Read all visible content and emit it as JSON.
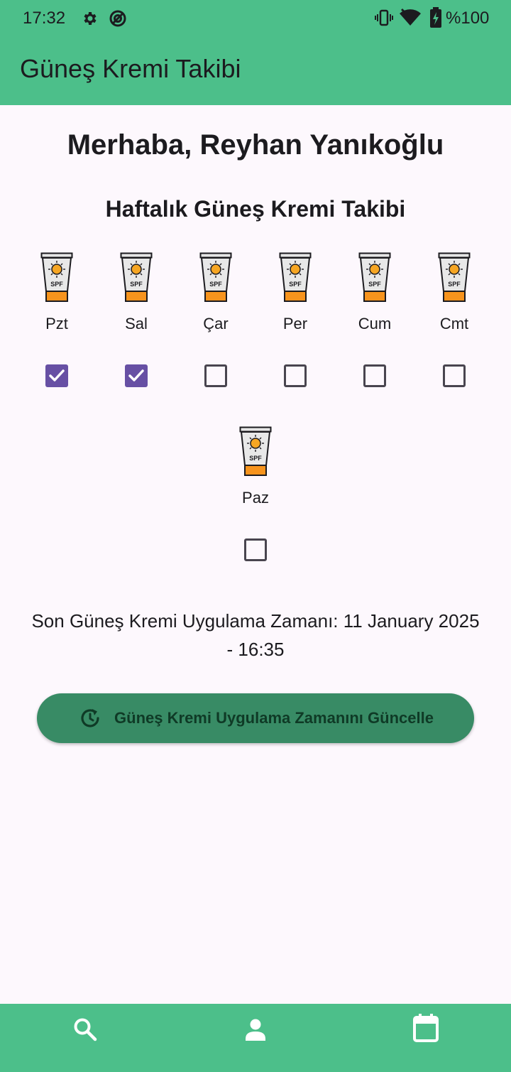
{
  "status_bar": {
    "time": "17:32",
    "battery": "%100",
    "icons": [
      "gear-icon",
      "data-saver-icon",
      "vibrate-icon",
      "wifi-icon",
      "battery-charging-icon"
    ]
  },
  "app_bar": {
    "title": "Güneş Kremi Takibi",
    "color": "#4cbf8a"
  },
  "main": {
    "greeting": "Merhaba, Reyhan Yanıkoğlu",
    "section_title": "Haftalık Güneş Kremi Takibi",
    "days": [
      {
        "label": "Pzt",
        "checked": true
      },
      {
        "label": "Sal",
        "checked": true
      },
      {
        "label": "Çar",
        "checked": false
      },
      {
        "label": "Per",
        "checked": false
      },
      {
        "label": "Cum",
        "checked": false
      },
      {
        "label": "Cmt",
        "checked": false
      },
      {
        "label": "Paz",
        "checked": false
      }
    ],
    "tube_text": "SPF",
    "last_applied": "Son Güneş Kremi Uygulama Zamanı: 11 January 2025 - 16:35",
    "update_button": {
      "label": "Güneş Kremi Uygulama Zamanını Güncelle",
      "icon": "refresh-clock-icon"
    }
  },
  "bottom_nav": {
    "items": [
      "search-icon",
      "person-icon",
      "calendar-icon"
    ]
  },
  "colors": {
    "accent": "#4cbf8a",
    "checkbox": "#6750a4",
    "button": "#388b65"
  }
}
